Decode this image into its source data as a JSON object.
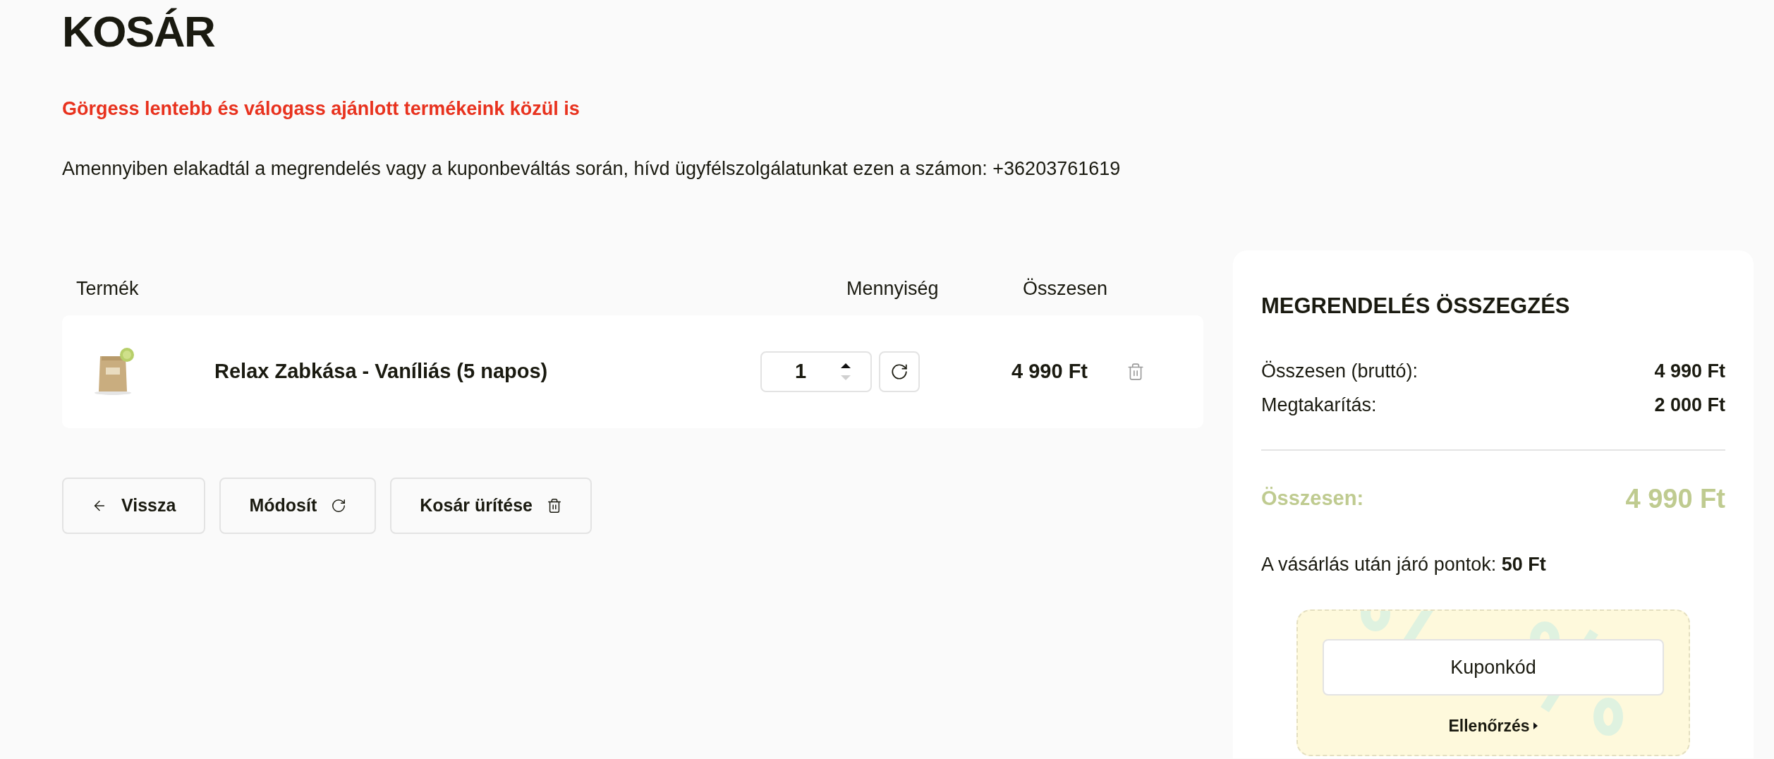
{
  "page_title": "KOSÁR",
  "notice": "Görgess lentebb és válogass ajánlott termékeink közül is",
  "help_text": "Amennyiben elakadtál a megrendelés vagy a kuponbeváltás során, hívd ügyfélszolgálatunkat ezen a számon: +36203761619",
  "table": {
    "columns": [
      "Termék",
      "Mennyiség",
      "Összesen"
    ],
    "rows": [
      {
        "name": "Relax Zabkása - Vaníliás (5 napos)",
        "quantity": "1",
        "total": "4 990 Ft"
      }
    ]
  },
  "actions": [
    {
      "kind": "back",
      "label": "Vissza"
    },
    {
      "kind": "update",
      "label": "Módosít"
    },
    {
      "kind": "clear",
      "label": "Kosár ürítése"
    }
  ],
  "summary": {
    "title": "MEGRENDELÉS ÖSSZEGZÉS",
    "lines": [
      {
        "label": "Összesen (bruttó):",
        "value": "4 990 Ft"
      },
      {
        "label": "Megtakarítás:",
        "value": "2 000 Ft"
      }
    ],
    "total_label": "Összesen:",
    "total_value": "4 990 Ft",
    "points_text": "A vásárlás után járó pontok: **50 Ft**",
    "coupon": {
      "placeholder": "Kuponkód",
      "check_label": "Ellenőrzés"
    }
  }
}
